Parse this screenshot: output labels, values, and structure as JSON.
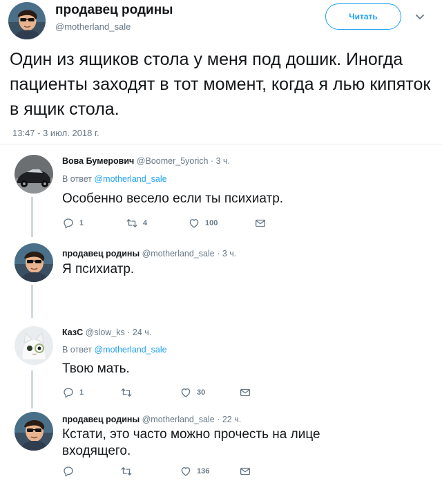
{
  "main_tweet": {
    "display_name": "продавец родины",
    "handle": "@motherland_sale",
    "follow_label": "Читать",
    "text": "Один из ящиков стола у меня под дошик. Иногда пациенты заходят в тот момент, когда я лью кипяток в ящик стола.",
    "timestamp": "13:47 - 3 июл. 2018 г."
  },
  "replies": [
    {
      "display_name": "Вова Бумерович",
      "meta": "@Boomer_5yorich · 3 ч.",
      "reply_prefix": "В ответ",
      "reply_to": "@motherland_sale",
      "text": "Особенно весело если ты психиатр.",
      "replies_count": "1",
      "retweets_count": "4",
      "likes_count": "100"
    },
    {
      "display_name": "продавец родины",
      "meta": "@motherland_sale · 3 ч.",
      "text": "Я психиатр."
    },
    {
      "display_name": "КазС",
      "meta": "@slow_ks · 24 ч.",
      "reply_prefix": "В ответ",
      "reply_to": "@motherland_sale",
      "text": "Твою мать.",
      "replies_count": "1",
      "retweets_count": "",
      "likes_count": "30"
    },
    {
      "display_name": "продавец родины",
      "meta": "@motherland_sale · 22 ч.",
      "text": "Кстати, это часто можно прочесть на лице входящего.",
      "replies_count": "",
      "retweets_count": "",
      "likes_count": "136"
    }
  ],
  "icons": {
    "reply": "speech-bubble-icon",
    "retweet": "retweet-icon",
    "like": "heart-icon",
    "dm": "envelope-icon",
    "caret": "chevron-down-icon"
  },
  "colors": {
    "accent": "#1da1f2",
    "muted": "#657786",
    "text": "#14171a",
    "thread_line": "#cfd9de"
  }
}
